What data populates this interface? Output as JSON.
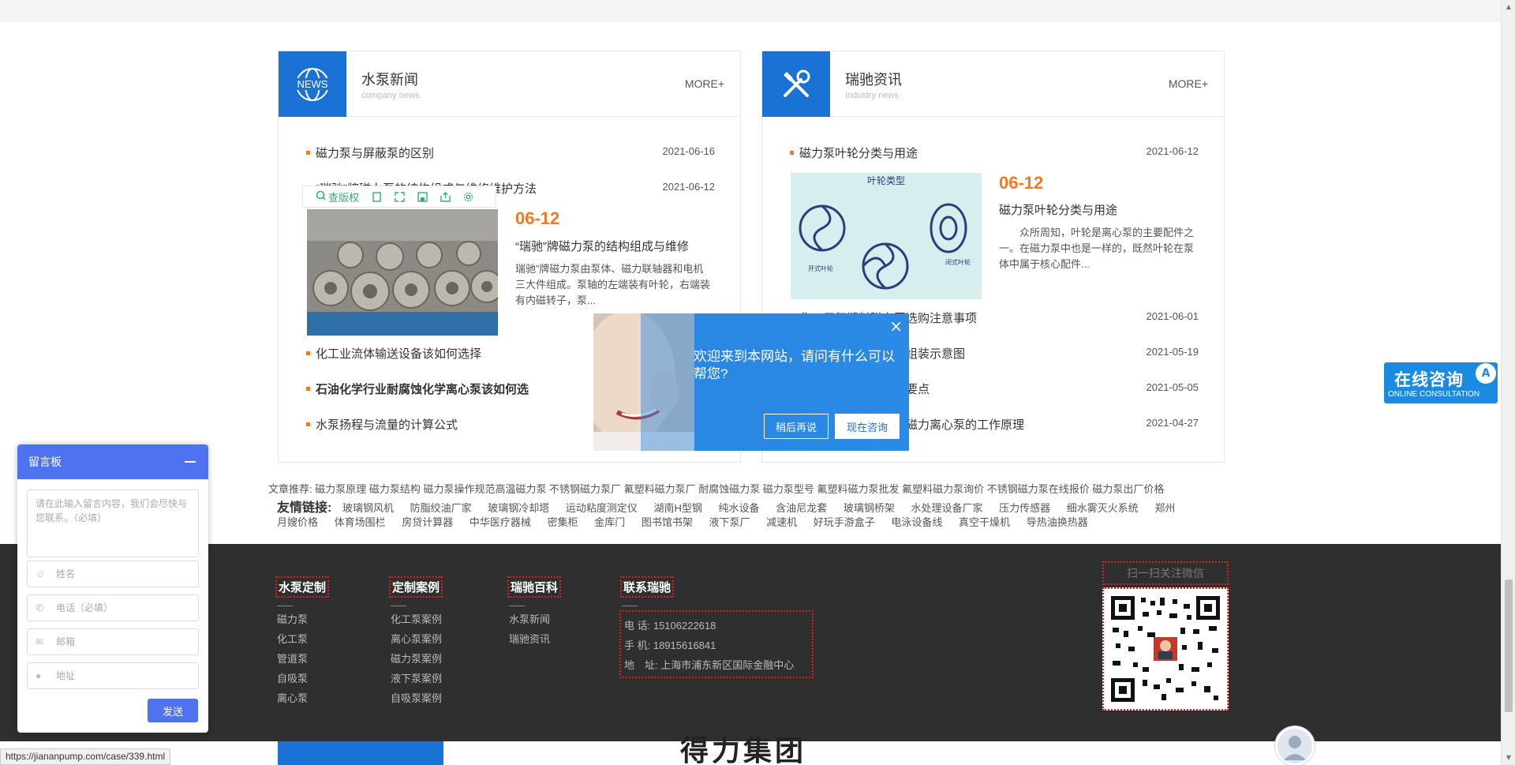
{
  "news_left": {
    "icon_label": "NEWS",
    "title": "水泵新闻",
    "subtitle": "company news",
    "more": "MORE+",
    "items": [
      {
        "title": "磁力泵与屏蔽泵的区别",
        "date": "2021-06-16"
      },
      {
        "title": "“瑞驰”牌磁力泵的结构组成与维修维护方法",
        "date": "2021-06-12"
      }
    ],
    "feature": {
      "date": "06-12",
      "title": "“瑞驰”牌磁力泵的结构组成与维修",
      "desc": "瑞驰”牌磁力泵由泵体、磁力联轴器和电机三大件组成。泵轴的左端装有叶轮，右端装有内磁转子，泵..."
    },
    "items_after": [
      {
        "title": "化工业流体输送设备该如何选择",
        "date": ""
      },
      {
        "title": "石油化学行业耐腐蚀化学离心泵该如何选",
        "date": ""
      },
      {
        "title": "水泵扬程与流量的计算公式",
        "date": ""
      }
    ]
  },
  "toolbar": {
    "check_label": "查版权"
  },
  "news_right": {
    "title": "瑞驰资讯",
    "subtitle": "Industry news",
    "more": "MORE+",
    "items": [
      {
        "title": "磁力泵叶轮分类与用途",
        "date": "2021-06-12"
      }
    ],
    "feature": {
      "img_title": "叶轮类型",
      "img_label_left": "开式叶轮",
      "img_label_right": "闭式叶轮",
      "date": "06-12",
      "title": "磁力泵叶轮分类与用途",
      "desc": "众所周知，叶轮是离心泵的主要配件之一。在磁力泵中也是一样的，既然叶轮在泵体中属于核心配件..."
    },
    "items_after": [
      {
        "title": "化工用氟塑料磁力泵选购注意事项",
        "date": "2021-06-01"
      },
      {
        "title": "耐腐蚀磁力泵的部件组装示意图",
        "date": "2021-05-19"
      },
      {
        "title": "不锈钢磁力泵的安装要点",
        "date": "2021-05-05"
      },
      {
        "title": "耐酸碱磁力泵和化工磁力离心泵的工作原理",
        "date": "2021-04-27"
      }
    ]
  },
  "article_links": "文章推荐: 磁力泵原理 磁力泵结构 磁力泵操作规范高温磁力泵 不锈钢磁力泵厂 氟塑料磁力泵厂 耐腐蚀磁力泵 磁力泵型号 氟塑料磁力泵批发 氟塑料磁力泵询价 不锈钢磁力泵在线报价 磁力泵出厂价格",
  "friend_links": {
    "label": "友情链接:",
    "row1": [
      "玻璃钢风机",
      "防脂绞油厂家",
      "玻璃钢冷却塔",
      "运动粘度测定仪",
      "湖南H型钢",
      "纯水设备",
      "含油尼龙套",
      "玻璃钢桥架",
      "水处理设备厂家",
      "压力传感器",
      "细水雾灭火系统",
      "郑州"
    ],
    "row2": [
      "月嫂价格",
      "体育场围栏",
      "房贷计算器",
      "中华医疗器械",
      "密集柜",
      "金库门",
      "图书馆书架",
      "液下泵厂",
      "减速机",
      "好玩手游盒子",
      "电泳设备线",
      "真空干燥机",
      "导热油换热器"
    ]
  },
  "footer": {
    "col1": {
      "title": "水泵定制",
      "items": [
        "磁力泵",
        "化工泵",
        "管道泵",
        "自吸泵",
        "离心泵"
      ]
    },
    "col2": {
      "title": "定制案例",
      "items": [
        "化工泵案例",
        "离心泵案例",
        "磁力泵案例",
        "液下泵案例",
        "自吸泵案例"
      ]
    },
    "col3": {
      "title": "瑞驰百科",
      "items": [
        "水泵新闻",
        "瑞驰资讯"
      ]
    },
    "col4": {
      "title": "联系瑞驰",
      "phone": "电 话: 15106222618",
      "mobile": "手 机: 18915616841",
      "address": "地　址: 上海市浦东新区国际金融中心"
    },
    "qr_label": "扫一扫关注微信",
    "group_name": "得力集团"
  },
  "modal": {
    "text": "欢迎来到本网站，请问有什么可以帮您?",
    "later": "稍后再说",
    "consult": "现在咨询",
    "close": "×"
  },
  "message_board": {
    "title": "留言板",
    "content_placeholder": "请在此输入留言内容，我们会尽快与您联系。（必填）",
    "name_placeholder": "姓名",
    "phone_placeholder": "电话（必填）",
    "email_placeholder": "邮箱",
    "address_placeholder": "地址",
    "send": "发送"
  },
  "consult_float": {
    "title": "在线咨询",
    "sub": "ONLINE CONSULTATION"
  },
  "status_url": "https://jiananpump.com/case/339.html",
  "colors": {
    "brand_blue": "#1a72d4",
    "accent_orange": "#f07a1e",
    "footer_bg": "#2f2f2f",
    "board_blue": "#4f73f0"
  }
}
